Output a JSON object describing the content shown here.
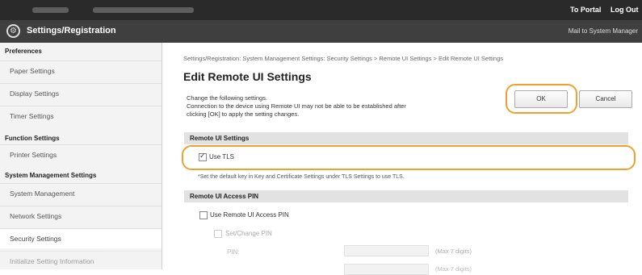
{
  "topbar": {
    "to_portal": "To Portal",
    "log_out": "Log Out"
  },
  "header": {
    "title": "Settings/Registration",
    "mail_to": "Mail to System Manager",
    "logo_icon": "gear-settings-icon"
  },
  "sidebar": {
    "sections": [
      {
        "heading": "Preferences",
        "items": [
          "Paper Settings",
          "Display Settings",
          "Timer Settings"
        ]
      },
      {
        "heading": "Function Settings",
        "items": [
          "Printer Settings"
        ]
      },
      {
        "heading": "System Management Settings",
        "items": [
          "System Management",
          "Network Settings",
          "Security Settings",
          "Initialize Setting Information"
        ]
      }
    ],
    "active": "Security Settings"
  },
  "main": {
    "breadcrumb": "Settings/Registration: System Management Settings: Security Settings > Remote UI Settings > Edit Remote UI Settings",
    "page_title": "Edit Remote UI Settings",
    "instructions": [
      "Change the following settings.",
      "Connection to the device using Remote UI may not be able to be established after",
      "clicking [OK] to apply the setting changes."
    ],
    "ok_label": "OK",
    "cancel_label": "Cancel",
    "remote_ui_settings": {
      "heading": "Remote UI Settings",
      "use_tls_label": "Use TLS",
      "use_tls_checked": true,
      "note": "*Set the default key in Key and Certificate Settings under TLS Settings to use TLS."
    },
    "access_pin": {
      "heading": "Remote UI Access PIN",
      "use_pin_label": "Use Remote UI Access PIN",
      "use_pin_checked": false,
      "set_change_label": "Set/Change PIN",
      "pin_label": "PIN:",
      "pin_hint": "(Max 7 digits)",
      "confirm_hint": "(Max 7 digits)"
    }
  },
  "colors": {
    "highlight": "#f0a030",
    "topbar": "#2a2a2a",
    "header": "#3f3f3f"
  }
}
